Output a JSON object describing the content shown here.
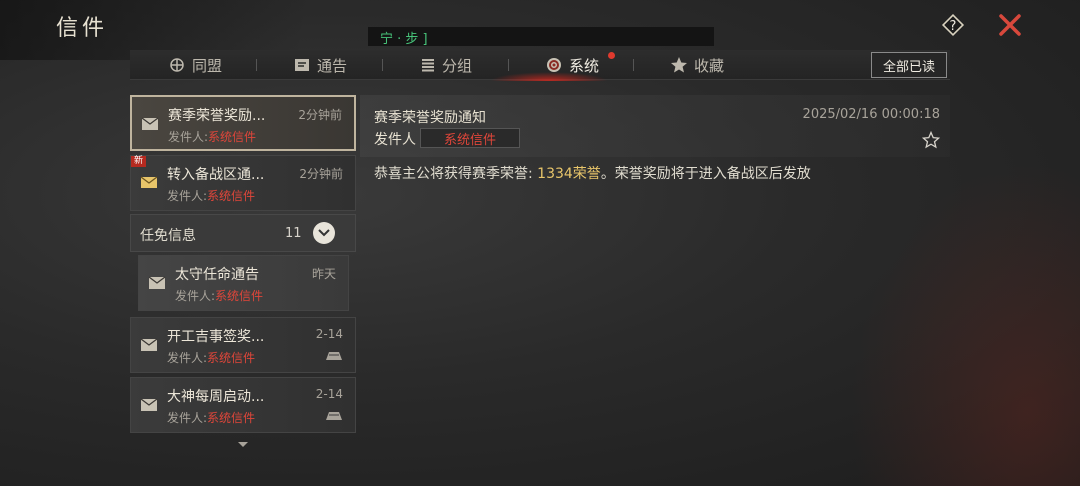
{
  "window": {
    "title": "信件"
  },
  "marquee": {
    "text": "宁 · 步 ]"
  },
  "tabs": [
    {
      "label": "同盟",
      "icon": "alliance-icon"
    },
    {
      "label": "通告",
      "icon": "notice-icon"
    },
    {
      "label": "分组",
      "icon": "group-icon"
    },
    {
      "label": "系统",
      "icon": "system-icon",
      "active": true
    },
    {
      "label": "收藏",
      "icon": "star-icon"
    }
  ],
  "toolbar": {
    "mark_all_read": "全部已读"
  },
  "mail_list": {
    "items": [
      {
        "subject": "赛季荣誉奖励...",
        "time": "2分钟前",
        "sender_prefix": "发件人:",
        "sender": "系统信件",
        "selected": true
      },
      {
        "subject": "转入备战区通...",
        "time": "2分钟前",
        "sender_prefix": "发件人:",
        "sender": "系统信件",
        "badge": "新"
      }
    ],
    "group": {
      "label": "任免信息",
      "count": "11"
    },
    "group_items": [
      {
        "subject": "太守任命通告",
        "time": "昨天",
        "sender_prefix": "发件人:",
        "sender": "系统信件"
      }
    ],
    "more_items": [
      {
        "subject": "开工吉事签奖...",
        "time": "2-14",
        "sender_prefix": "发件人:",
        "sender": "系统信件"
      },
      {
        "subject": "大神每周启动...",
        "time": "2-14",
        "sender_prefix": "发件人:",
        "sender": "系统信件"
      }
    ]
  },
  "detail": {
    "title": "赛季荣誉奖励通知",
    "date": "2025/02/16 00:00:18",
    "sender_label": "发件人",
    "sender": "系统信件",
    "body_prefix": "恭喜主公将获得赛季荣誉: ",
    "body_highlight": "1334荣誉",
    "body_suffix": "。荣誉奖励将于进入备战区后发放"
  },
  "colors": {
    "accent_red": "#e0463a",
    "highlight_gold": "#e8c56a",
    "marquee_green": "#47c47a"
  }
}
